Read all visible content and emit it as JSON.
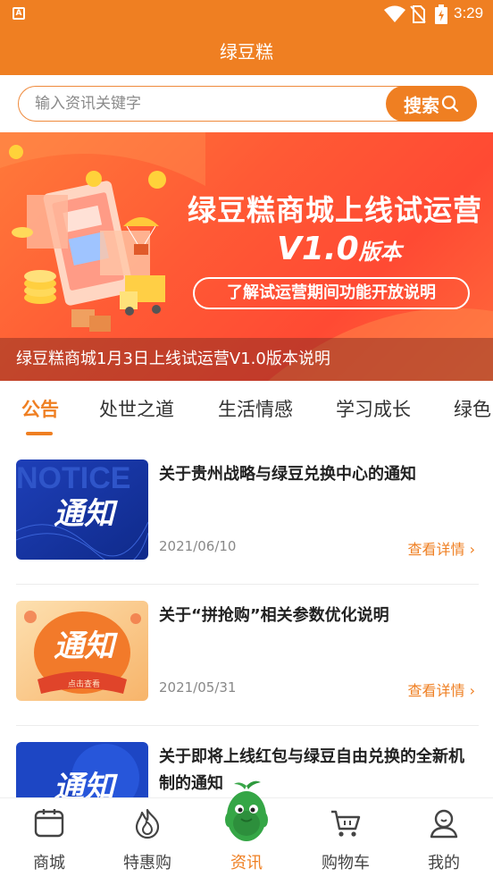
{
  "status_bar": {
    "time": "3:29",
    "icons": [
      "app-notification-icon",
      "wifi-icon",
      "no-sim-icon",
      "battery-charging-icon"
    ]
  },
  "header": {
    "title": "绿豆糕"
  },
  "search": {
    "placeholder": "输入资讯关键字",
    "button_label": "搜索",
    "icon": "search-icon"
  },
  "banner": {
    "headline": "绿豆糕商城上线试运营",
    "version": "V1.0",
    "version_suffix": "版本",
    "pill": "了解试运营期间功能开放说明",
    "caption": "绿豆糕商城1月3日上线试运营V1.0版本说明"
  },
  "tabs": [
    {
      "label": "公告",
      "active": true
    },
    {
      "label": "处世之道",
      "active": false
    },
    {
      "label": "生活情感",
      "active": false
    },
    {
      "label": "学习成长",
      "active": false
    },
    {
      "label": "绿色",
      "active": false
    }
  ],
  "articles": [
    {
      "title": "关于贵州战略与绿豆兑换中心的通知",
      "date": "2021/06/10",
      "more": "查看详情",
      "thumb_text": "通知",
      "thumb_bg": "NOTICE"
    },
    {
      "title": "关于“拼抢购”相关参数优化说明",
      "date": "2021/05/31",
      "more": "查看详情",
      "thumb_text": "通知",
      "thumb_sub": "点击查看"
    },
    {
      "title": "关于即将上线红包与绿豆自由兑换的全新机制的通知",
      "date": "",
      "more": "",
      "thumb_text": "通知"
    }
  ],
  "bottom_nav": [
    {
      "label": "商城",
      "icon": "shop-icon",
      "active": false
    },
    {
      "label": "特惠购",
      "icon": "flame-icon",
      "active": false
    },
    {
      "label": "资讯",
      "icon": "mascot-icon",
      "active": true
    },
    {
      "label": "购物车",
      "icon": "cart-icon",
      "active": false
    },
    {
      "label": "我的",
      "icon": "user-icon",
      "active": false
    }
  ],
  "colors": {
    "accent": "#ef7f22",
    "banner": "#ff5a35",
    "text": "#222222",
    "muted": "#888888"
  }
}
